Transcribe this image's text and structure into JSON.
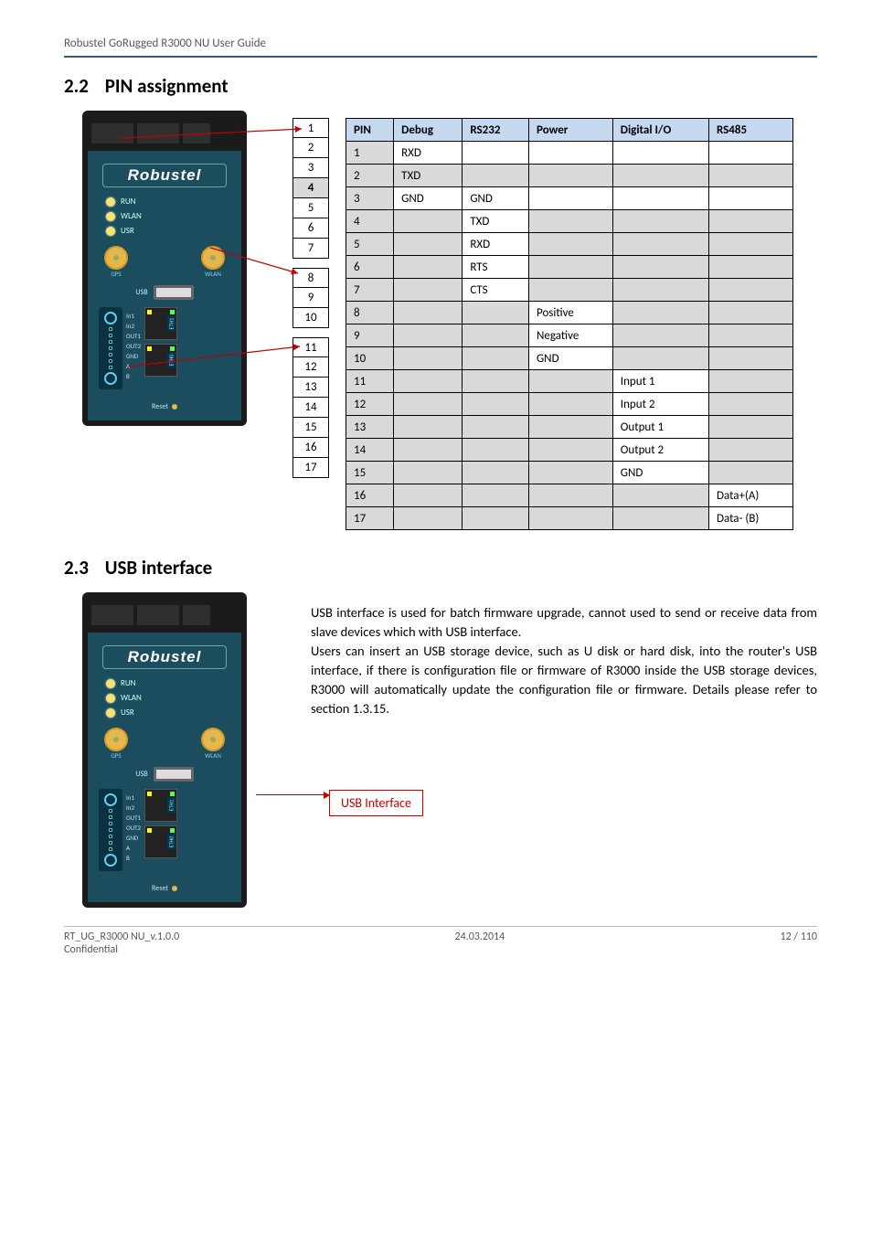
{
  "header": {
    "title": "Robustel GoRugged R3000 NU User Guide"
  },
  "sections": {
    "pin": {
      "num": "2.2",
      "title": "PIN assignment"
    },
    "usb": {
      "num": "2.3",
      "title": "USB interface"
    }
  },
  "device": {
    "brand": "Robustel",
    "leds": [
      "RUN",
      "WLAN",
      "USR"
    ],
    "ant_left": "GPS",
    "ant_right": "WLAN",
    "usb_label": "USB",
    "tb_labels": [
      "In1",
      "In2",
      "OUT1",
      "OUT2",
      "GND",
      "A",
      "B"
    ],
    "eth_labels": [
      "ETH1",
      "ETH0"
    ],
    "reset": "Reset"
  },
  "pin_list": {
    "group1": [
      "1",
      "2",
      "3",
      "4",
      "5",
      "6",
      "7"
    ],
    "group2": [
      "8",
      "9",
      "10"
    ],
    "group3": [
      "11",
      "12",
      "13",
      "14",
      "15",
      "16",
      "17"
    ],
    "highlight": "4"
  },
  "pin_table": {
    "headers": [
      "PIN",
      "Debug",
      "RS232",
      "Power",
      "Digital I/O",
      "RS485"
    ],
    "rows": [
      {
        "pin": "1",
        "cells": [
          "RXD",
          "",
          "",
          "",
          ""
        ],
        "shade": [
          false,
          false,
          false,
          false,
          false
        ]
      },
      {
        "pin": "2",
        "cells": [
          "TXD",
          "",
          "",
          "",
          ""
        ],
        "shade": [
          true,
          true,
          true,
          true,
          true
        ]
      },
      {
        "pin": "3",
        "cells": [
          "GND",
          "GND",
          "",
          "",
          ""
        ],
        "shade": [
          false,
          false,
          false,
          false,
          false
        ]
      },
      {
        "pin": "4",
        "cells": [
          "",
          "TXD",
          "",
          "",
          ""
        ],
        "shade": [
          true,
          false,
          true,
          true,
          true
        ]
      },
      {
        "pin": "5",
        "cells": [
          "",
          "RXD",
          "",
          "",
          ""
        ],
        "shade": [
          true,
          false,
          true,
          true,
          true
        ]
      },
      {
        "pin": "6",
        "cells": [
          "",
          "RTS",
          "",
          "",
          ""
        ],
        "shade": [
          true,
          false,
          true,
          true,
          true
        ]
      },
      {
        "pin": "7",
        "cells": [
          "",
          "CTS",
          "",
          "",
          ""
        ],
        "shade": [
          true,
          false,
          true,
          true,
          true
        ]
      },
      {
        "pin": "8",
        "cells": [
          "",
          "",
          "Positive",
          "",
          ""
        ],
        "shade": [
          true,
          true,
          false,
          true,
          true
        ]
      },
      {
        "pin": "9",
        "cells": [
          "",
          "",
          "Negative",
          "",
          ""
        ],
        "shade": [
          true,
          true,
          false,
          true,
          true
        ]
      },
      {
        "pin": "10",
        "cells": [
          "",
          "",
          "GND",
          "",
          ""
        ],
        "shade": [
          true,
          true,
          false,
          true,
          true
        ]
      },
      {
        "pin": "11",
        "cells": [
          "",
          "",
          "",
          "Input 1",
          ""
        ],
        "shade": [
          true,
          true,
          true,
          false,
          true
        ]
      },
      {
        "pin": "12",
        "cells": [
          "",
          "",
          "",
          "Input 2",
          ""
        ],
        "shade": [
          true,
          true,
          true,
          false,
          true
        ]
      },
      {
        "pin": "13",
        "cells": [
          "",
          "",
          "",
          "Output 1",
          ""
        ],
        "shade": [
          true,
          true,
          true,
          false,
          true
        ]
      },
      {
        "pin": "14",
        "cells": [
          "",
          "",
          "",
          "Output 2",
          ""
        ],
        "shade": [
          true,
          true,
          true,
          false,
          true
        ]
      },
      {
        "pin": "15",
        "cells": [
          "",
          "",
          "",
          "GND",
          ""
        ],
        "shade": [
          true,
          true,
          true,
          false,
          true
        ]
      },
      {
        "pin": "16",
        "cells": [
          "",
          "",
          "",
          "",
          "Data+(A)"
        ],
        "shade": [
          true,
          true,
          true,
          true,
          false
        ]
      },
      {
        "pin": "17",
        "cells": [
          "",
          "",
          "",
          "",
          "Data- (B)"
        ],
        "shade": [
          true,
          true,
          true,
          true,
          false
        ]
      }
    ]
  },
  "usb_text": {
    "p1": "USB interface is used for batch firmware upgrade, cannot used to send or receive data from slave devices which with USB interface.",
    "p2": "Users can insert an USB storage device, such as U disk or hard disk, into the router's USB interface, if there is configuration file or firmware of R3000 inside the USB storage devices, R3000 will automatically update the configuration file or firmware. Details please refer to section 1.3.15.",
    "callout": "USB Interface"
  },
  "footer": {
    "left1": "RT_UG_R3000 NU_v.1.0.0",
    "left2": "Confidential",
    "center": "24.03.2014",
    "right": "12 / 110"
  }
}
